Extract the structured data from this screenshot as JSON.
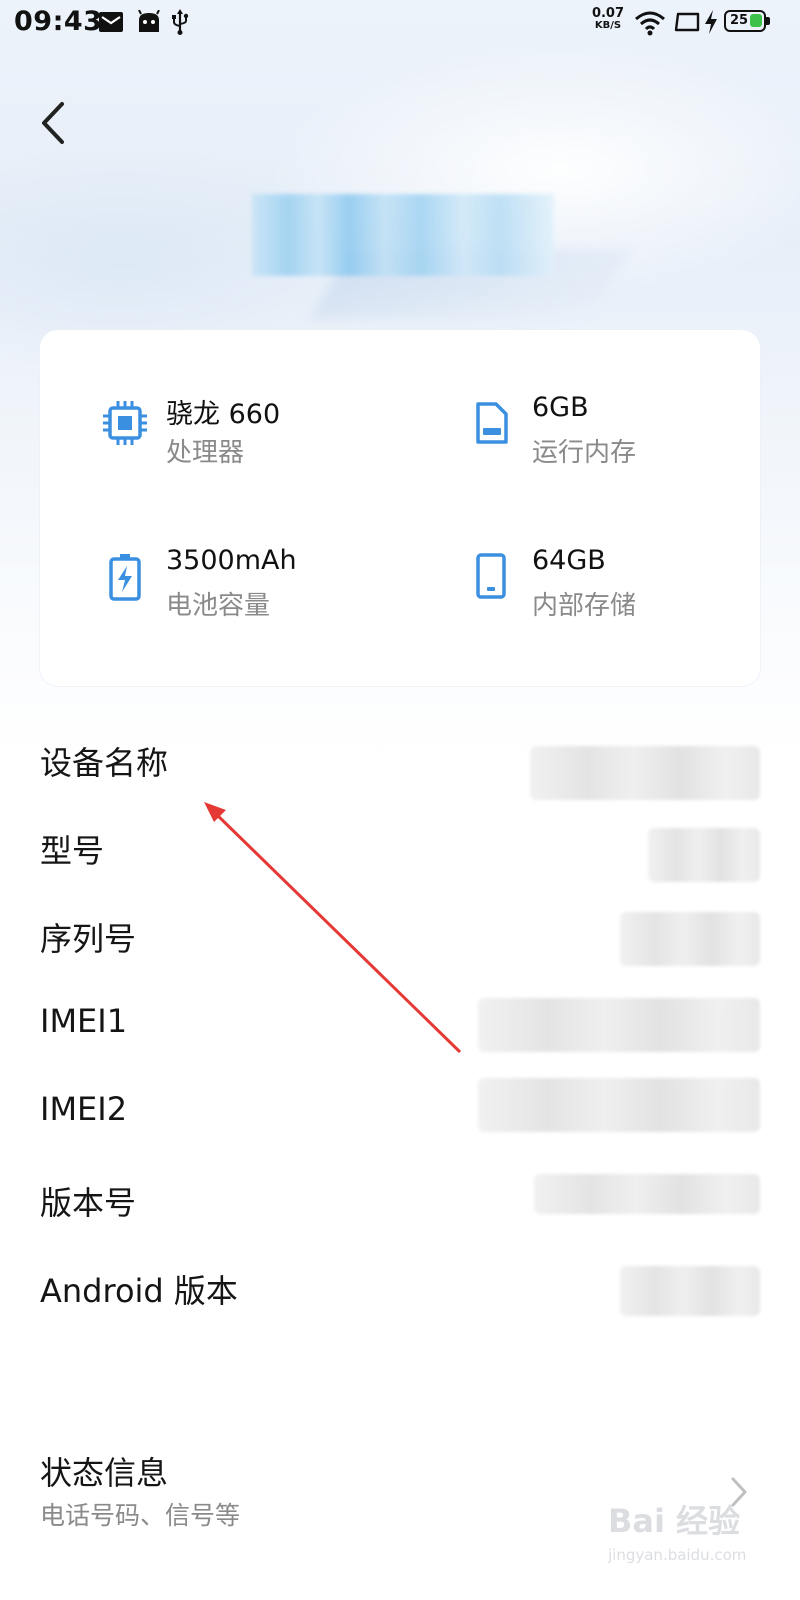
{
  "status_bar": {
    "time": "09:43",
    "net_speed_value": "0.07",
    "net_speed_unit": "KB/S",
    "battery_level": "25"
  },
  "specs": [
    {
      "icon": "chip-icon",
      "value": "骁龙 660",
      "label": "处理器"
    },
    {
      "icon": "memory-card-icon",
      "value": "6GB",
      "label": "运行内存"
    },
    {
      "icon": "battery-icon",
      "value": "3500mAh",
      "label": "电池容量"
    },
    {
      "icon": "phone-storage-icon",
      "value": "64GB",
      "label": "内部存储"
    }
  ],
  "info_rows": [
    {
      "label": "设备名称"
    },
    {
      "label": "型号"
    },
    {
      "label": "序列号"
    },
    {
      "label": "IMEI1"
    },
    {
      "label": "IMEI2"
    },
    {
      "label": "版本号"
    },
    {
      "label": "Android 版本"
    }
  ],
  "status_info": {
    "title": "状态信息",
    "subtitle": "电话号码、信号等"
  },
  "watermark": {
    "brand": "Bai 经验",
    "url": "jingyan.baidu.com"
  },
  "colors": {
    "accent_blue": "#3a8fe0",
    "annotation_red": "#e53935",
    "battery_green": "#3cc24a"
  }
}
